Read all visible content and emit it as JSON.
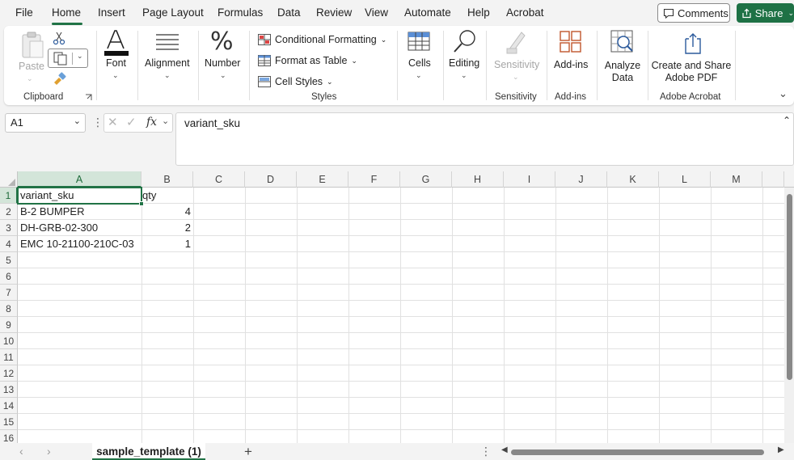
{
  "menu": {
    "tabs": [
      "File",
      "Home",
      "Insert",
      "Page Layout",
      "Formulas",
      "Data",
      "Review",
      "View",
      "Automate",
      "Help",
      "Acrobat"
    ],
    "active": "Home",
    "comments_label": "Comments",
    "share_label": "Share"
  },
  "ribbon": {
    "clipboard": {
      "paste": "Paste",
      "group": "Clipboard"
    },
    "font": {
      "label": "Font"
    },
    "alignment": {
      "label": "Alignment"
    },
    "number": {
      "label": "Number"
    },
    "styles": {
      "conditional": "Conditional Formatting",
      "format_table": "Format as Table",
      "cell_styles": "Cell Styles",
      "group": "Styles"
    },
    "cells": {
      "label": "Cells"
    },
    "editing": {
      "label": "Editing"
    },
    "sensitivity": {
      "label": "Sensitivity",
      "group": "Sensitivity"
    },
    "addins": {
      "label": "Add-ins",
      "group": "Add-ins"
    },
    "analyze": {
      "line1": "Analyze",
      "line2": "Data"
    },
    "acrobat": {
      "line1": "Create and Share",
      "line2": "Adobe PDF",
      "group": "Adobe Acrobat"
    }
  },
  "formula_bar": {
    "name_box": "A1",
    "fx": "fx",
    "content": "variant_sku"
  },
  "grid": {
    "columns": [
      "A",
      "B",
      "C",
      "D",
      "E",
      "F",
      "G",
      "H",
      "I",
      "J",
      "K",
      "L",
      "M"
    ],
    "rows": [
      "1",
      "2",
      "3",
      "4",
      "5",
      "6",
      "7",
      "8",
      "9",
      "10",
      "11",
      "12",
      "13",
      "14",
      "15",
      "16"
    ],
    "cells": {
      "a1": "variant_sku",
      "b1": "qty",
      "a2": "B-2 BUMPER",
      "b2": "4",
      "a3": "DH-GRB-02-300",
      "b3": "2",
      "a4": "EMC 10-21100-210C-03",
      "b4": "1"
    }
  },
  "sheets": {
    "active": "sample_template (1)",
    "add": "+"
  },
  "colors": {
    "accent": "#217346",
    "share_bg": "#1e7145"
  }
}
